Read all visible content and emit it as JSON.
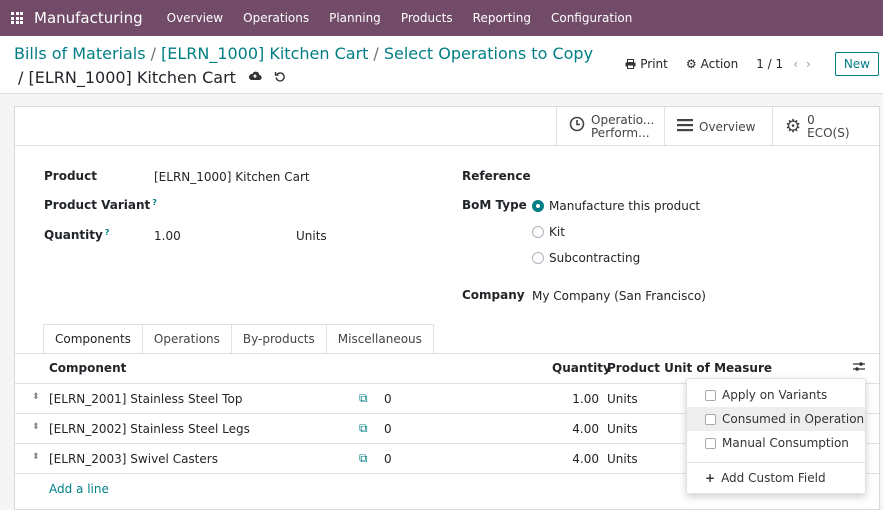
{
  "navbar": {
    "app_name": "Manufacturing",
    "menu": [
      "Overview",
      "Operations",
      "Planning",
      "Products",
      "Reporting",
      "Configuration"
    ]
  },
  "breadcrumb": {
    "items": [
      "Bills of Materials",
      "[ELRN_1000] Kitchen Cart",
      "Select Operations to Copy"
    ],
    "separator": "/",
    "current_prefix": "/",
    "current": "[ELRN_1000] Kitchen Cart"
  },
  "controls": {
    "print": "Print",
    "action": "Action",
    "pager": "1 / 1",
    "new": "New"
  },
  "smart_buttons": {
    "operations": [
      "Operatio...",
      "Perform..."
    ],
    "overview": "Overview",
    "eco_count": "0",
    "eco_label": "ECO(S)"
  },
  "form": {
    "product_label": "Product",
    "product_value": "[ELRN_1000] Kitchen Cart",
    "variant_label": "Product Variant",
    "quantity_label": "Quantity",
    "quantity_value": "1.00",
    "quantity_uom": "Units",
    "help_mark": "?",
    "reference_label": "Reference",
    "bom_type_label": "BoM Type",
    "bom_types": [
      "Manufacture this product",
      "Kit",
      "Subcontracting"
    ],
    "company_label": "Company",
    "company_value": "My Company (San Francisco)"
  },
  "tabs": [
    "Components",
    "Operations",
    "By-products",
    "Miscellaneous"
  ],
  "table": {
    "headers": {
      "component": "Component",
      "quantity": "Quantity",
      "uom": "Product Unit of Measure"
    },
    "rows": [
      {
        "component": "[ELRN_2001] Stainless Steel Top",
        "consumed": "0",
        "quantity": "1.00",
        "uom": "Units"
      },
      {
        "component": "[ELRN_2002] Stainless Steel Legs",
        "consumed": "0",
        "quantity": "4.00",
        "uom": "Units"
      },
      {
        "component": "[ELRN_2003] Swivel Casters",
        "consumed": "0",
        "quantity": "4.00",
        "uom": "Units"
      }
    ],
    "add_line": "Add a line"
  },
  "column_dropdown": {
    "options": [
      "Apply on Variants",
      "Consumed in Operation",
      "Manual Consumption"
    ],
    "add_custom": "Add Custom Field"
  },
  "colors": {
    "navbar": "#714B67",
    "accent": "#017e84"
  }
}
